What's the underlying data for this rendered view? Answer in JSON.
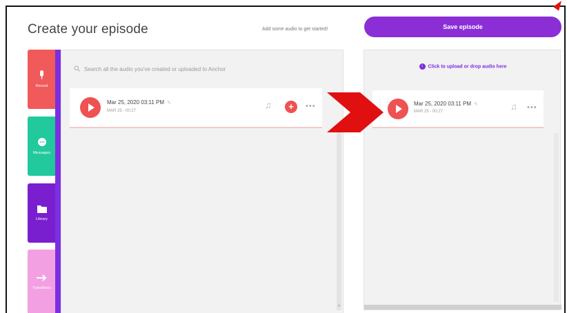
{
  "header": {
    "title": "Create your episode",
    "hint": "Add some audio to get started!",
    "save_label": "Save episode"
  },
  "sidebar": {
    "items": [
      {
        "label": "Record",
        "icon": "microphone-icon",
        "color": "#f05a5a"
      },
      {
        "label": "Messages",
        "icon": "message-icon",
        "color": "#22c99c"
      },
      {
        "label": "Library",
        "icon": "folder-icon",
        "color": "#7a1fcf"
      },
      {
        "label": "Transitions",
        "icon": "arrow-right-icon",
        "color": "#f3a0e2"
      }
    ]
  },
  "library": {
    "search_placeholder": "Search all the audio you've created or uploaded to Anchor",
    "item": {
      "title": "Mar 25, 2020 03:11 PM",
      "meta": "MAR 25 - 00:27"
    }
  },
  "episode": {
    "upload_label": "Click to upload or drop audio here",
    "item": {
      "title": "Mar 25, 2020 03:11 PM",
      "meta": "MAR 25 - 00:27"
    }
  },
  "colors": {
    "accent": "#8b2ed6",
    "play": "#ee5252",
    "annotation_arrow": "#e01010"
  }
}
